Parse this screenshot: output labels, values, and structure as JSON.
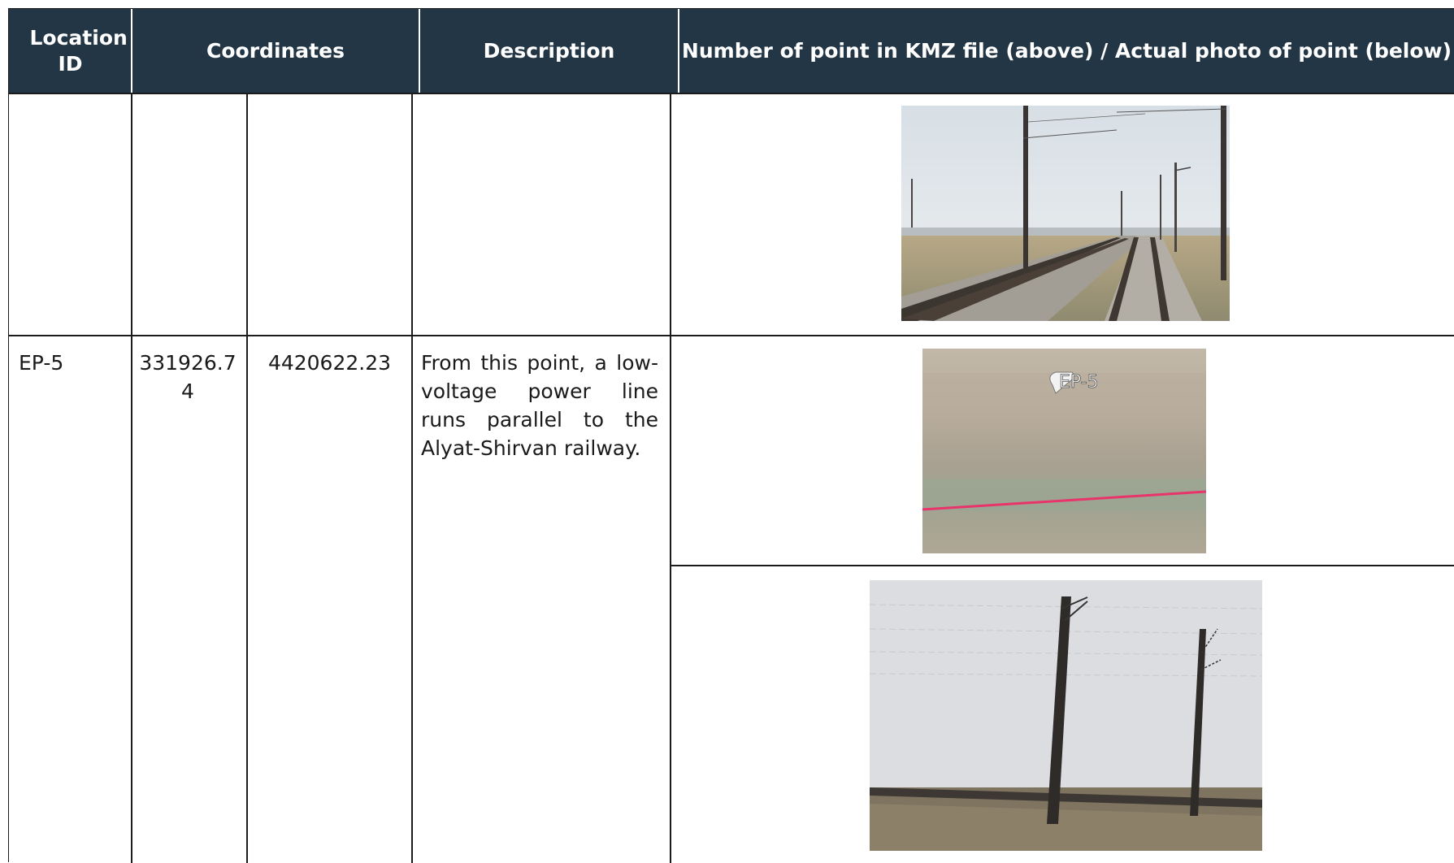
{
  "table": {
    "headers": {
      "location_id": "Location ID",
      "coordinates": "Coordinates",
      "description": "Description",
      "kmz_photo": "Number of point in KMZ file (above) / Actual photo of point (below)"
    },
    "rows": [
      {
        "location_id": "",
        "easting": "",
        "northing": "",
        "description": "",
        "photo": "railway-tracks-photo"
      },
      {
        "location_id": "EP-5",
        "easting": "331926.74",
        "northing": "4420622.23",
        "description": "From this point, a low-voltage power line runs parallel to the Alyat-Shirvan railway.",
        "kmz_label": "EP-5",
        "photo_kmz": "kmz-map-snapshot",
        "photo_actual": "power-poles-photo"
      }
    ]
  },
  "colors": {
    "header_bg": "#233645",
    "header_text": "#ffffff",
    "border": "#1b1b1b",
    "kmz_line": "#e8336b"
  }
}
